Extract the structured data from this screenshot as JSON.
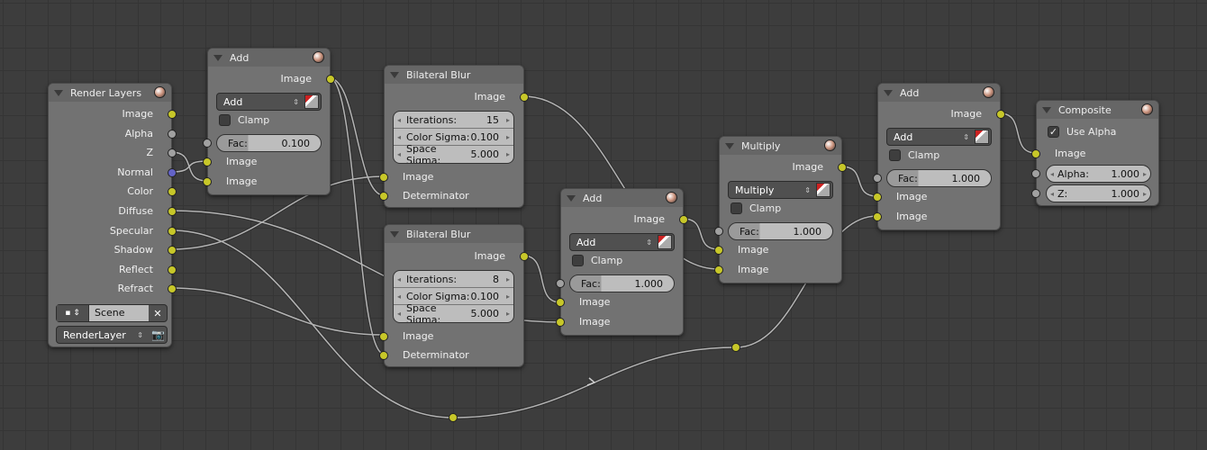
{
  "render_layers": {
    "title": "Render Layers",
    "outputs": [
      "Image",
      "Alpha",
      "Z",
      "Normal",
      "Color",
      "Diffuse",
      "Specular",
      "Shadow",
      "Reflect",
      "Refract"
    ],
    "scene": "Scene",
    "layer": "RenderLayer"
  },
  "add1": {
    "title": "Add",
    "out": "Image",
    "blend": "Add",
    "clamp": "Clamp",
    "fac_label": "Fac:",
    "fac": "0.100",
    "in1": "Image",
    "in2": "Image"
  },
  "blur1": {
    "title": "Bilateral Blur",
    "out": "Image",
    "iter_label": "Iterations:",
    "iter": "15",
    "cs_label": "Color Sigma:",
    "cs": "0.100",
    "ss_label": "Space Sigma:",
    "ss": "5.000",
    "in1": "Image",
    "in2": "Determinator"
  },
  "blur2": {
    "title": "Bilateral Blur",
    "out": "Image",
    "iter_label": "Iterations:",
    "iter": "8",
    "cs_label": "Color Sigma:",
    "cs": "0.100",
    "ss_label": "Space Sigma:",
    "ss": "5.000",
    "in1": "Image",
    "in2": "Determinator"
  },
  "add2": {
    "title": "Add",
    "out": "Image",
    "blend": "Add",
    "clamp": "Clamp",
    "fac_label": "Fac:",
    "fac": "1.000",
    "in1": "Image",
    "in2": "Image"
  },
  "multiply": {
    "title": "Multiply",
    "out": "Image",
    "blend": "Multiply",
    "clamp": "Clamp",
    "fac_label": "Fac:",
    "fac": "1.000",
    "in1": "Image",
    "in2": "Image"
  },
  "add3": {
    "title": "Add",
    "out": "Image",
    "blend": "Add",
    "clamp": "Clamp",
    "fac_label": "Fac:",
    "fac": "1.000",
    "in1": "Image",
    "in2": "Image"
  },
  "composite": {
    "title": "Composite",
    "use_alpha": "Use Alpha",
    "in_image": "Image",
    "alpha_label": "Alpha:",
    "alpha": "1.000",
    "z_label": "Z:",
    "z": "1.000"
  }
}
